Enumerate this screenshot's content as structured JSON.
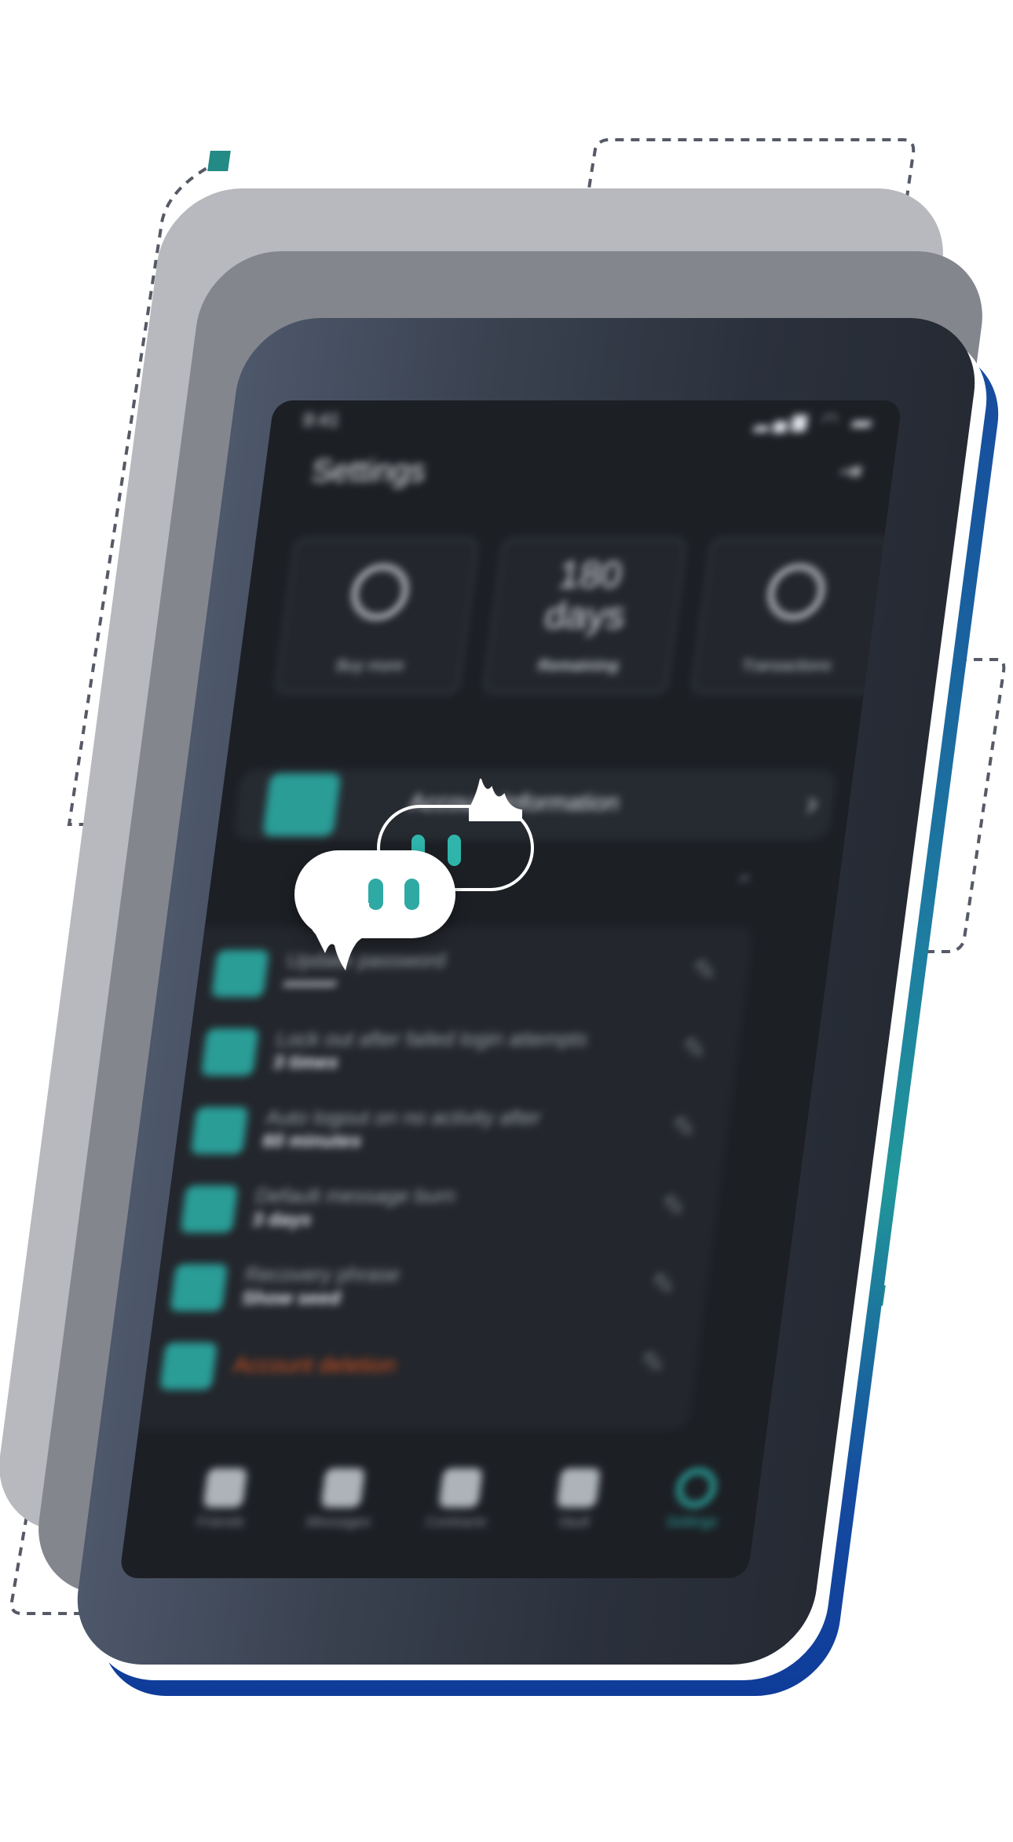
{
  "status_bar": {
    "time": "9:41",
    "icons": "▂▄▆ ◠ ▬"
  },
  "header": {
    "title": "Settings",
    "logout_icon": "logout-icon"
  },
  "cards": [
    {
      "icon": "plus-circle-icon",
      "label": "Buy more"
    },
    {
      "big_number": "180",
      "big_unit": "days",
      "label": "Remaining"
    },
    {
      "icon": "shield-icon",
      "label": "Transactions"
    }
  ],
  "account": {
    "label": "Account Information",
    "chevron": "›"
  },
  "section": {
    "caret": "⌃"
  },
  "rows": [
    {
      "label": "Update password",
      "value": "••••••••",
      "edit": "✎"
    },
    {
      "label": "Lock out after failed login attempts",
      "value": "3 times",
      "edit": "✎"
    },
    {
      "label": "Auto logout on no activity after",
      "value": "60 minutes",
      "edit": "✎"
    },
    {
      "label": "Default message burn",
      "value": "3 days",
      "edit": "✎"
    },
    {
      "label": "Recovery phrase",
      "value": "Show seed",
      "edit": "✎"
    },
    {
      "danger": "Account deletion",
      "edit": "✎"
    }
  ],
  "nav": [
    {
      "label": "Friends",
      "active": false
    },
    {
      "label": "Messages",
      "active": false
    },
    {
      "label": "Contracts",
      "active": false
    },
    {
      "label": "Vault",
      "active": false
    },
    {
      "label": "Settings",
      "active": true
    }
  ],
  "colors": {
    "accent": "#2a9d97",
    "marker": "#238a86",
    "danger": "#d2511f",
    "dash": "#565a66",
    "phone_edge": "#0f3c9a"
  }
}
